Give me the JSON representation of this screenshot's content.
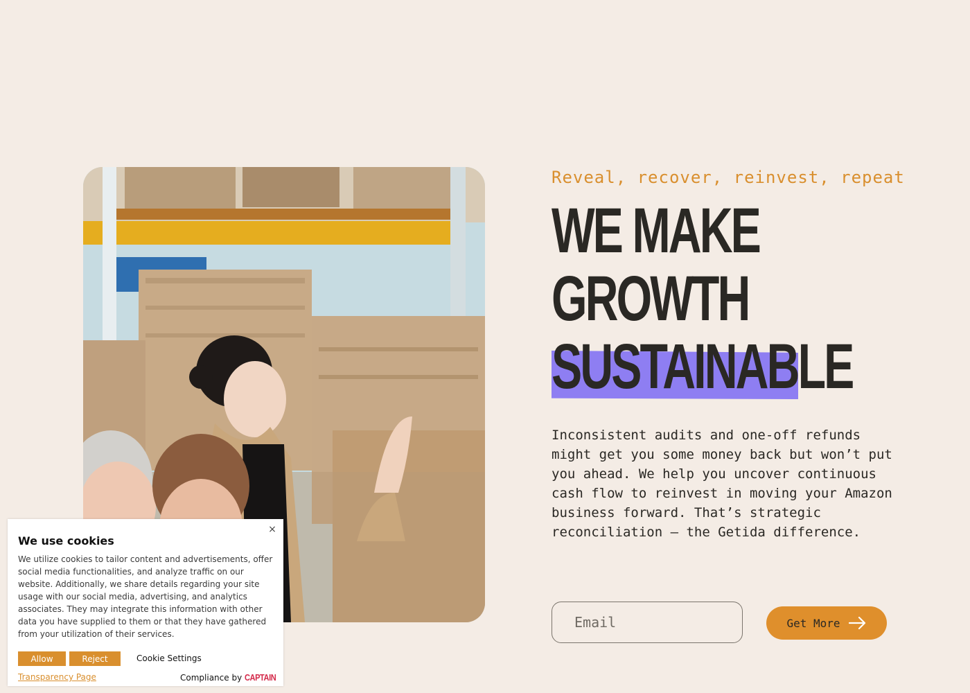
{
  "hero": {
    "tagline": "Reveal, recover, reinvest, repeat",
    "headline_lines": [
      "WE MAKE",
      "GROWTH",
      "SUSTAINABLE"
    ],
    "body": "Inconsistent audits and one-off refunds might get you some money back but won’t put you ahead. We help you uncover continuous cash flow to reinvest in moving your Amazon business forward. That’s strategic reconciliation — the Getida difference.",
    "email_placeholder": "Email",
    "cta_label": "Get More",
    "cta_icon": "arrow-right-icon"
  },
  "cookie_banner": {
    "title": "We use cookies",
    "text": "We utilize cookies to tailor content and advertisements, offer social media functionalities, and analyze traffic on our website. Additionally, we share details regarding your site usage with our social media, advertising, and analytics associates. They may integrate this information with other data you have supplied to them or that they have gathered from your utilization of their services.",
    "allow_label": "Allow",
    "reject_label": "Reject",
    "settings_label": "Cookie Settings",
    "transparency_label": "Transparency Page",
    "compliance_label": "Compliance by",
    "compliance_brand": "CAPTAIN",
    "close_symbol": "×"
  },
  "colors": {
    "background": "#f4ece5",
    "accent_orange": "#df8f2c",
    "highlight_purple": "#8e7ef2",
    "text_dark": "#2a2824"
  }
}
